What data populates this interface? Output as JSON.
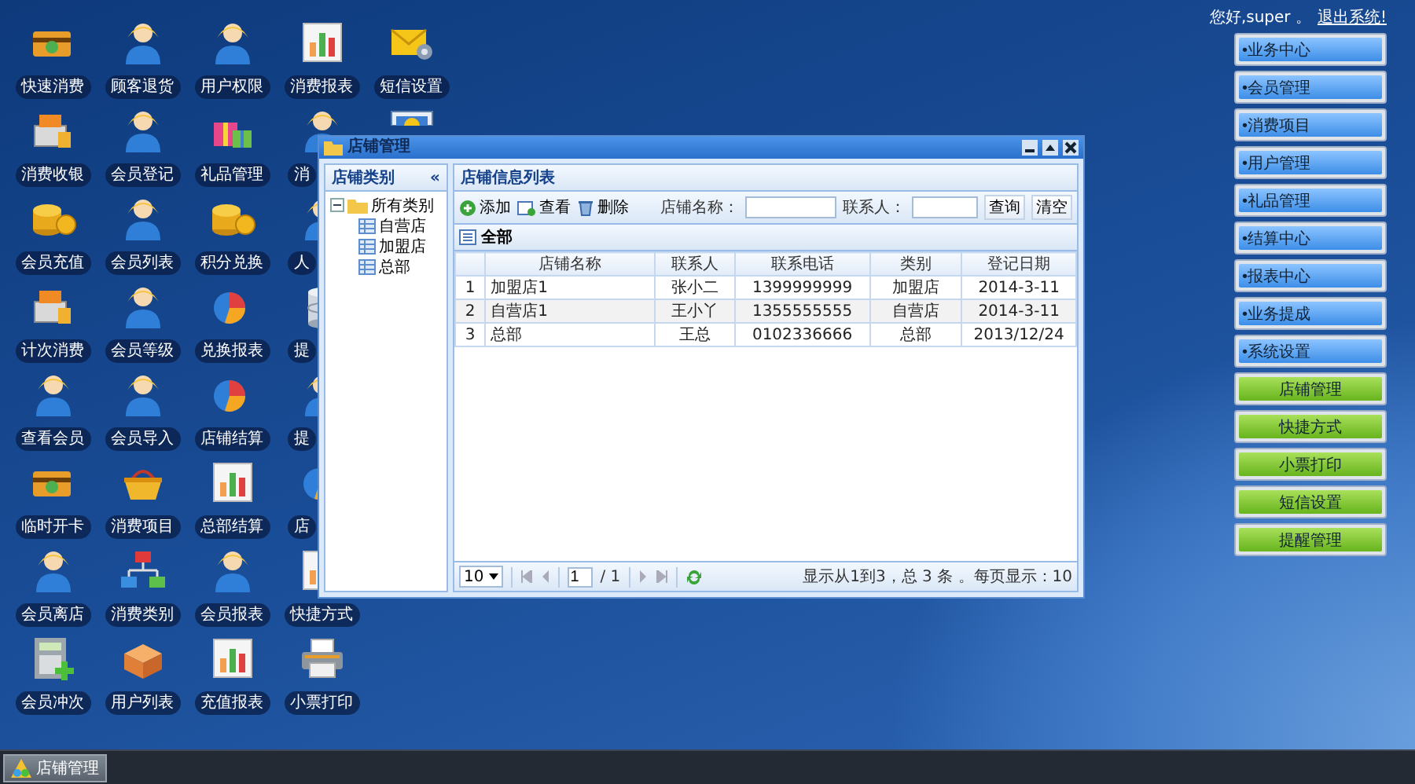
{
  "desktop_icons": [
    {
      "kind": "shortcut",
      "label": "快速消费"
    },
    {
      "kind": "shortcut",
      "label": "顾客退货"
    },
    {
      "kind": "shortcut",
      "label": "用户权限"
    },
    {
      "kind": "shortcut",
      "label": "消费报表"
    },
    {
      "kind": "shortcut",
      "label": "短信设置"
    },
    {
      "kind": "shortcut",
      "label": "消费收银"
    },
    {
      "kind": "shortcut",
      "label": "会员登记"
    },
    {
      "kind": "shortcut",
      "label": "礼品管理"
    },
    {
      "kind": "partial",
      "label": "消"
    },
    {
      "kind": "icon_only"
    },
    {
      "kind": "shortcut",
      "label": "会员充值"
    },
    {
      "kind": "shortcut",
      "label": "会员列表"
    },
    {
      "kind": "shortcut",
      "label": "积分兑换"
    },
    {
      "kind": "partial",
      "label": "人"
    },
    {
      "kind": "blank"
    },
    {
      "kind": "shortcut",
      "label": "计次消费"
    },
    {
      "kind": "shortcut",
      "label": "会员等级"
    },
    {
      "kind": "shortcut",
      "label": "兑换报表"
    },
    {
      "kind": "partial",
      "label": "提"
    },
    {
      "kind": "blank"
    },
    {
      "kind": "shortcut",
      "label": "查看会员"
    },
    {
      "kind": "shortcut",
      "label": "会员导入"
    },
    {
      "kind": "shortcut",
      "label": "店铺结算"
    },
    {
      "kind": "partial",
      "label": "提"
    },
    {
      "kind": "blank"
    },
    {
      "kind": "shortcut",
      "label": "临时开卡"
    },
    {
      "kind": "shortcut",
      "label": "消费项目"
    },
    {
      "kind": "shortcut",
      "label": "总部结算"
    },
    {
      "kind": "partial",
      "label": "店"
    },
    {
      "kind": "blank"
    },
    {
      "kind": "shortcut",
      "label": "会员离店"
    },
    {
      "kind": "shortcut",
      "label": "消费类别"
    },
    {
      "kind": "shortcut",
      "label": "会员报表"
    },
    {
      "kind": "shortcut",
      "label": "快捷方式"
    },
    {
      "kind": "blank"
    },
    {
      "kind": "shortcut",
      "label": "会员冲次"
    },
    {
      "kind": "shortcut",
      "label": "用户列表"
    },
    {
      "kind": "shortcut",
      "label": "充值报表"
    },
    {
      "kind": "shortcut",
      "label": "小票打印"
    },
    {
      "kind": "blank"
    }
  ],
  "user_bar": {
    "greeting": "您好,super 。",
    "logout": "退出系统!"
  },
  "menu": [
    {
      "label": "•业务中心",
      "kind": "category"
    },
    {
      "label": "•会员管理",
      "kind": "category"
    },
    {
      "label": "•消费项目",
      "kind": "category"
    },
    {
      "label": "•用户管理",
      "kind": "category"
    },
    {
      "label": "•礼品管理",
      "kind": "category"
    },
    {
      "label": "•结算中心",
      "kind": "category"
    },
    {
      "label": "•报表中心",
      "kind": "category"
    },
    {
      "label": "•业务提成",
      "kind": "category"
    },
    {
      "label": "•系统设置",
      "kind": "category"
    },
    {
      "label": "店铺管理",
      "kind": "shortcut"
    },
    {
      "label": "快捷方式",
      "kind": "shortcut"
    },
    {
      "label": "小票打印",
      "kind": "shortcut"
    },
    {
      "label": "短信设置",
      "kind": "shortcut"
    },
    {
      "label": "提醒管理",
      "kind": "shortcut"
    }
  ],
  "window": {
    "title": "店铺管理",
    "tree_panel": {
      "title": "店铺类别",
      "collapse": "«",
      "tree": [
        {
          "label": "所有类别",
          "expanded": true,
          "children": [
            {
              "label": "自营店"
            },
            {
              "label": "加盟店"
            },
            {
              "label": "总部"
            }
          ]
        }
      ]
    },
    "list_panel": {
      "title": "店铺信息列表",
      "toolbar": {
        "actions": [
          {
            "label": "添加",
            "kind": "add"
          },
          {
            "label": "查看",
            "kind": "view"
          },
          {
            "label": "删除",
            "kind": "delete"
          }
        ],
        "filters": [
          {
            "label": "店铺名称："
          },
          {
            "label": "联系人："
          }
        ],
        "buttons": [
          "查询",
          "清空"
        ]
      },
      "grid_title": "全部",
      "table": {
        "columns": [
          "店铺名称",
          "联系人",
          "联系电话",
          "类别",
          "登记日期"
        ],
        "rows": [
          {
            "number": "1",
            "cells": [
              "加盟店1",
              "张小二",
              "1399999999",
              "加盟店",
              "2014-3-11"
            ]
          },
          {
            "number": "2",
            "cells": [
              "自营店1",
              "王小丫",
              "1355555555",
              "自营店",
              "2014-3-11"
            ]
          },
          {
            "number": "3",
            "cells": [
              "总部",
              "王总",
              "0102336666",
              "总部",
              "2013/12/24"
            ]
          }
        ]
      },
      "pager": {
        "page_size": "10",
        "page": "1",
        "page_count": "/ 1",
        "summary": "显示从1到3，总 3 条 。每页显示：10"
      }
    }
  },
  "taskbar": {
    "items": [
      {
        "label": "店铺管理"
      }
    ]
  }
}
